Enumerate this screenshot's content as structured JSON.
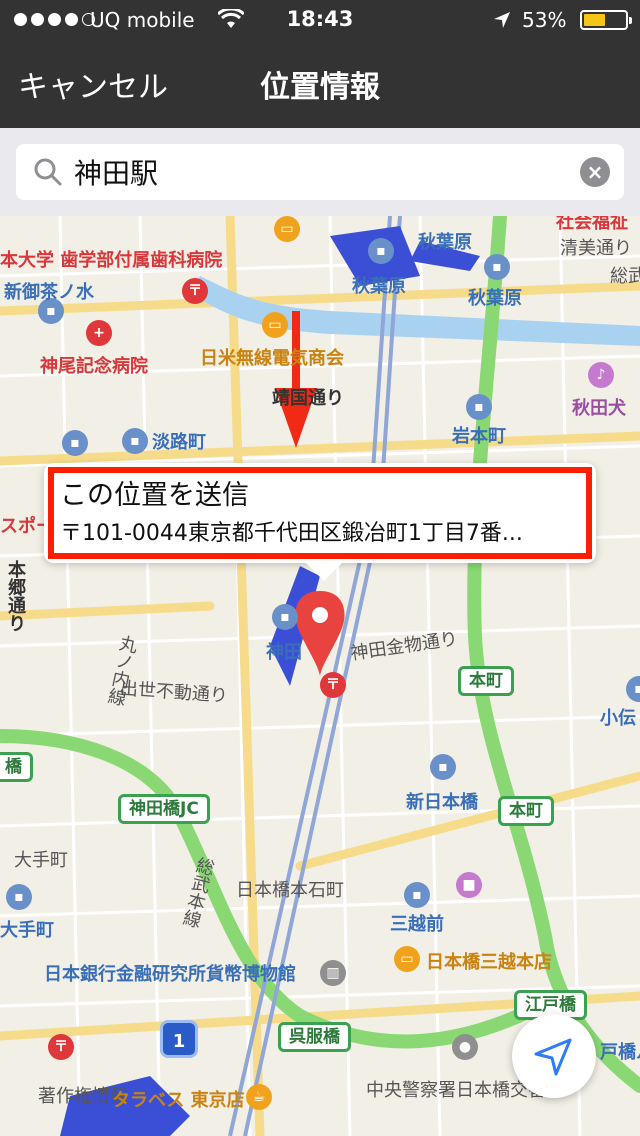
{
  "status_bar": {
    "carrier": "UQ mobile",
    "time": "18:43",
    "battery_percent": "53%",
    "battery_level": 0.53,
    "signal_bars_filled": 4,
    "signal_bars_total": 5
  },
  "nav": {
    "cancel_label": "キャンセル",
    "title": "位置情報"
  },
  "search": {
    "value": "神田駅"
  },
  "callout": {
    "title": "この位置を送信",
    "address": "〒101-0044東京都千代田区鍛冶町1丁目7番..."
  },
  "map_labels": {
    "dental_hospital": "本大学 歯学部付属歯科病院",
    "shin_ochanomizu": "新御茶ノ水",
    "kamio_hospital": "神尾記念病院",
    "nichibei_musen": "日米無線電気商会",
    "yasukuni_dori": "靖国通り",
    "awajicho": "淡路町",
    "akihabara_1": "秋葉原",
    "akihabara_2": "秋葉原",
    "akihabara_3": "秋葉原",
    "kiyosumi_dori": "清美通り",
    "so_1": "総武",
    "akitaken": "秋田犬",
    "iwamotocho": "岩本町",
    "shakai_fukushi": "社会福祉",
    "sports": "スポー",
    "hongo_dori": "本郷通り",
    "kanda_station": "神田",
    "kanda_kanamono_dori": "神田金物通り",
    "marunouchi_line": "丸ノ内線",
    "desefudo_dori": "出世不動通り",
    "honcho_1": "本町",
    "honcho_2": "本町",
    "kodenma": "小伝",
    "hashi": "橋",
    "shin_nihonbashi": "新日本橋",
    "kandabashi_jc": "神田橋JC",
    "otemachi_1": "大手町",
    "otemachi_2": "大手町",
    "nihonbashi_hongokucho": "日本橋本石町",
    "sobu_line": "総武本線",
    "mitsukoshimae": "三越前",
    "mitsukoshi_store": "日本橋三越本店",
    "currency_museum": "日本銀行金融研究所貨幣博物館",
    "edobashi": "江戸橋",
    "gofukubashi": "呉服橋",
    "route_1": "1",
    "chosakuken": "著作権情報",
    "tarabesu": "タラベス 東京店",
    "police": "中央警察署日本橋交番",
    "tobashi": "戸橋ル"
  },
  "colors": {
    "nav_bg": "#333333",
    "callout_border": "#fe1f00",
    "pin": "#e8433f",
    "arrow": "#f02a14",
    "expressway": "#7ed36f",
    "rail_station": "#3b4fd6"
  },
  "icons": {
    "search": "magnifier-icon",
    "clear": "clear-circle-icon",
    "pin": "map-pin-icon",
    "locate": "location-arrow-icon"
  }
}
